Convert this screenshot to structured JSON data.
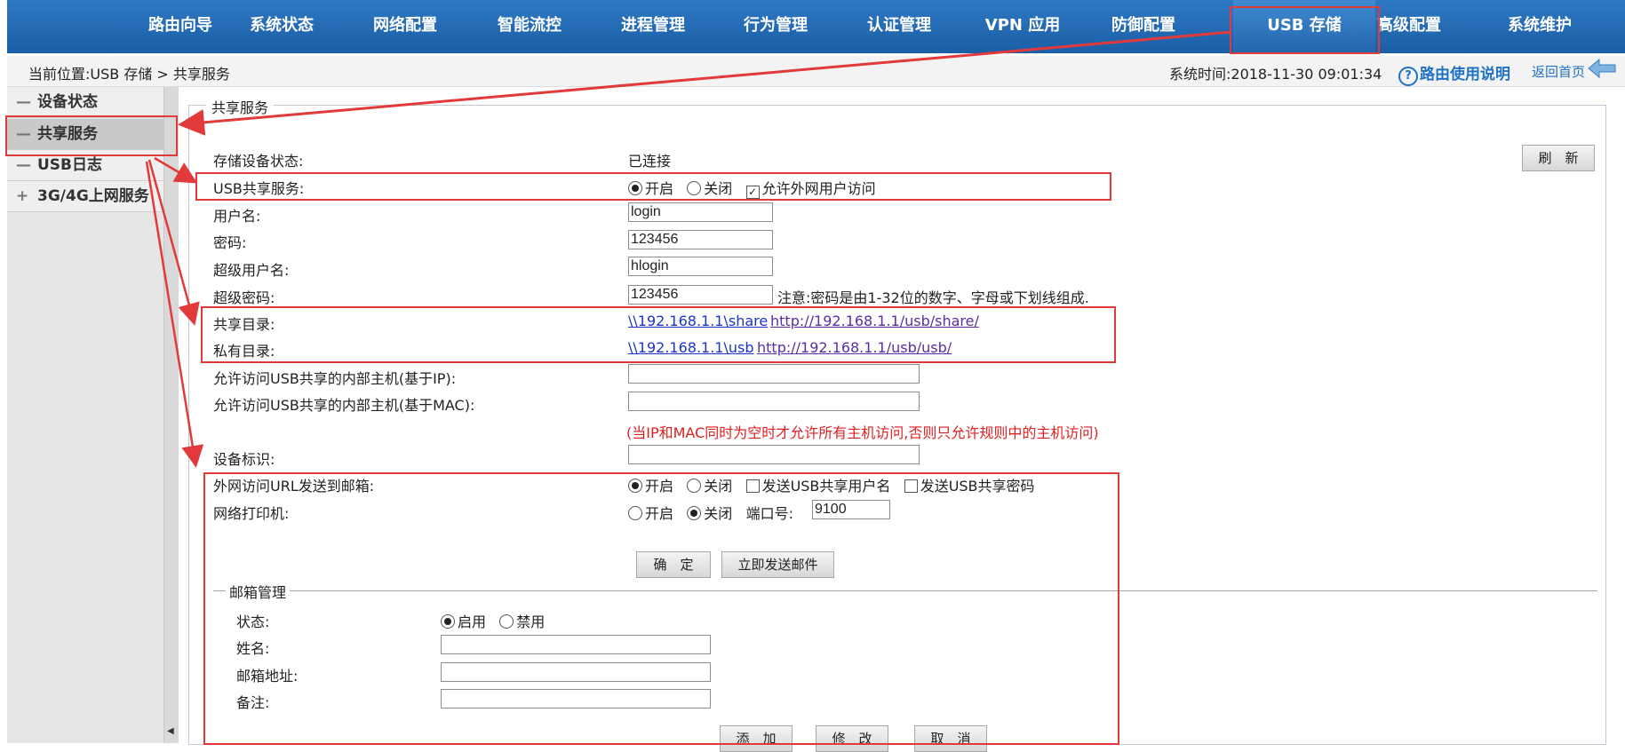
{
  "nav": {
    "items": [
      "路由向导",
      "系统状态",
      "网络配置",
      "智能流控",
      "进程管理",
      "行为管理",
      "认证管理",
      "VPN 应用",
      "防御配置",
      "USB 存储",
      "高级配置",
      "系统维护"
    ],
    "active": "USB 存储"
  },
  "header": {
    "breadcrumb": "当前位置:USB 存储 > 共享服务",
    "system_time": "系统时间:2018-11-30 09:01:34",
    "help_icon": "?",
    "help": "路由使用说明",
    "back_home": "返回首页"
  },
  "sidebar": {
    "items": [
      {
        "icon": "—",
        "label": "设备状态"
      },
      {
        "icon": "—",
        "label": "共享服务"
      },
      {
        "icon": "—",
        "label": "USB日志"
      },
      {
        "icon": "+",
        "label": "3G/4G上网服务"
      }
    ]
  },
  "main": {
    "legend": "共享服务",
    "refresh_label": "刷　新",
    "storage_status": {
      "label": "存储设备状态:",
      "value": "已连接"
    },
    "usb_share": {
      "label": "USB共享服务:",
      "on": "开启",
      "off": "关闭",
      "allow_wan": "允许外网用户访问"
    },
    "username": {
      "label": "用户名:",
      "value": "login"
    },
    "password": {
      "label": "密码:",
      "value": "123456"
    },
    "super_username": {
      "label": "超级用户名:",
      "value": "hlogin"
    },
    "super_password": {
      "label": "超级密码:",
      "value": "123456",
      "note": "注意:密码是由1-32位的数字、字母或下划线组成."
    },
    "share_dir": {
      "label": "共享目录:",
      "smb": "\\\\192.168.1.1\\share",
      "http": "http://192.168.1.1/usb/share/"
    },
    "private_dir": {
      "label": "私有目录:",
      "smb": "\\\\192.168.1.1\\usb",
      "http": "http://192.168.1.1/usb/usb/"
    },
    "allow_ip": {
      "label": "允许访问USB共享的内部主机(基于IP):",
      "value": ""
    },
    "allow_mac": {
      "label": "允许访问USB共享的内部主机(基于MAC):",
      "value": ""
    },
    "ip_mac_note": "(当IP和MAC同时为空时才允许所有主机访问,否则只允许规则中的主机访问)",
    "device_id": {
      "label": "设备标识:",
      "value": ""
    },
    "wan_url_mail": {
      "label": "外网访问URL发送到邮箱:",
      "on": "开启",
      "off": "关闭",
      "send_user": "发送USB共享用户名",
      "send_pass": "发送USB共享密码"
    },
    "net_printer": {
      "label": "网络打印机:",
      "on": "开启",
      "off": "关闭",
      "port_label": "端口号:",
      "port": "9100"
    },
    "ok_label": "确　定",
    "send_mail_label": "立即发送邮件"
  },
  "mailbox": {
    "legend": "邮箱管理",
    "status": {
      "label": "状态:",
      "on": "启用",
      "off": "禁用"
    },
    "name": {
      "label": "姓名:",
      "value": ""
    },
    "address": {
      "label": "邮箱地址:",
      "value": ""
    },
    "remark": {
      "label": "备注:",
      "value": ""
    },
    "add_label": "添　加",
    "edit_label": "修　改",
    "cancel_label": "取　消"
  },
  "colors": {
    "nav_blue": "#1f65ad",
    "highlight_red": "#e23a3a",
    "link_blue": "#1b34c9"
  }
}
